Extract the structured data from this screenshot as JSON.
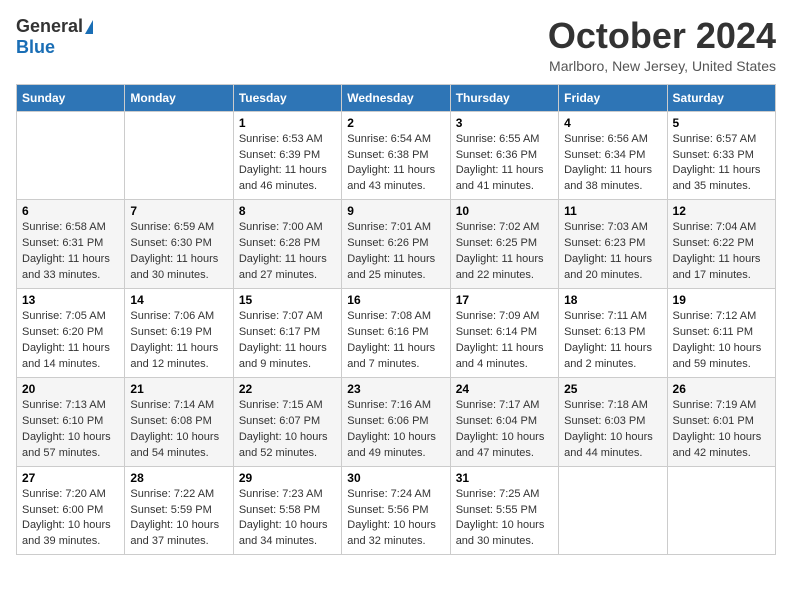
{
  "header": {
    "logo_general": "General",
    "logo_blue": "Blue",
    "title": "October 2024",
    "location": "Marlboro, New Jersey, United States"
  },
  "weekdays": [
    "Sunday",
    "Monday",
    "Tuesday",
    "Wednesday",
    "Thursday",
    "Friday",
    "Saturday"
  ],
  "weeks": [
    [
      {
        "day": "",
        "sunrise": "",
        "sunset": "",
        "daylight": ""
      },
      {
        "day": "",
        "sunrise": "",
        "sunset": "",
        "daylight": ""
      },
      {
        "day": "1",
        "sunrise": "Sunrise: 6:53 AM",
        "sunset": "Sunset: 6:39 PM",
        "daylight": "Daylight: 11 hours and 46 minutes."
      },
      {
        "day": "2",
        "sunrise": "Sunrise: 6:54 AM",
        "sunset": "Sunset: 6:38 PM",
        "daylight": "Daylight: 11 hours and 43 minutes."
      },
      {
        "day": "3",
        "sunrise": "Sunrise: 6:55 AM",
        "sunset": "Sunset: 6:36 PM",
        "daylight": "Daylight: 11 hours and 41 minutes."
      },
      {
        "day": "4",
        "sunrise": "Sunrise: 6:56 AM",
        "sunset": "Sunset: 6:34 PM",
        "daylight": "Daylight: 11 hours and 38 minutes."
      },
      {
        "day": "5",
        "sunrise": "Sunrise: 6:57 AM",
        "sunset": "Sunset: 6:33 PM",
        "daylight": "Daylight: 11 hours and 35 minutes."
      }
    ],
    [
      {
        "day": "6",
        "sunrise": "Sunrise: 6:58 AM",
        "sunset": "Sunset: 6:31 PM",
        "daylight": "Daylight: 11 hours and 33 minutes."
      },
      {
        "day": "7",
        "sunrise": "Sunrise: 6:59 AM",
        "sunset": "Sunset: 6:30 PM",
        "daylight": "Daylight: 11 hours and 30 minutes."
      },
      {
        "day": "8",
        "sunrise": "Sunrise: 7:00 AM",
        "sunset": "Sunset: 6:28 PM",
        "daylight": "Daylight: 11 hours and 27 minutes."
      },
      {
        "day": "9",
        "sunrise": "Sunrise: 7:01 AM",
        "sunset": "Sunset: 6:26 PM",
        "daylight": "Daylight: 11 hours and 25 minutes."
      },
      {
        "day": "10",
        "sunrise": "Sunrise: 7:02 AM",
        "sunset": "Sunset: 6:25 PM",
        "daylight": "Daylight: 11 hours and 22 minutes."
      },
      {
        "day": "11",
        "sunrise": "Sunrise: 7:03 AM",
        "sunset": "Sunset: 6:23 PM",
        "daylight": "Daylight: 11 hours and 20 minutes."
      },
      {
        "day": "12",
        "sunrise": "Sunrise: 7:04 AM",
        "sunset": "Sunset: 6:22 PM",
        "daylight": "Daylight: 11 hours and 17 minutes."
      }
    ],
    [
      {
        "day": "13",
        "sunrise": "Sunrise: 7:05 AM",
        "sunset": "Sunset: 6:20 PM",
        "daylight": "Daylight: 11 hours and 14 minutes."
      },
      {
        "day": "14",
        "sunrise": "Sunrise: 7:06 AM",
        "sunset": "Sunset: 6:19 PM",
        "daylight": "Daylight: 11 hours and 12 minutes."
      },
      {
        "day": "15",
        "sunrise": "Sunrise: 7:07 AM",
        "sunset": "Sunset: 6:17 PM",
        "daylight": "Daylight: 11 hours and 9 minutes."
      },
      {
        "day": "16",
        "sunrise": "Sunrise: 7:08 AM",
        "sunset": "Sunset: 6:16 PM",
        "daylight": "Daylight: 11 hours and 7 minutes."
      },
      {
        "day": "17",
        "sunrise": "Sunrise: 7:09 AM",
        "sunset": "Sunset: 6:14 PM",
        "daylight": "Daylight: 11 hours and 4 minutes."
      },
      {
        "day": "18",
        "sunrise": "Sunrise: 7:11 AM",
        "sunset": "Sunset: 6:13 PM",
        "daylight": "Daylight: 11 hours and 2 minutes."
      },
      {
        "day": "19",
        "sunrise": "Sunrise: 7:12 AM",
        "sunset": "Sunset: 6:11 PM",
        "daylight": "Daylight: 10 hours and 59 minutes."
      }
    ],
    [
      {
        "day": "20",
        "sunrise": "Sunrise: 7:13 AM",
        "sunset": "Sunset: 6:10 PM",
        "daylight": "Daylight: 10 hours and 57 minutes."
      },
      {
        "day": "21",
        "sunrise": "Sunrise: 7:14 AM",
        "sunset": "Sunset: 6:08 PM",
        "daylight": "Daylight: 10 hours and 54 minutes."
      },
      {
        "day": "22",
        "sunrise": "Sunrise: 7:15 AM",
        "sunset": "Sunset: 6:07 PM",
        "daylight": "Daylight: 10 hours and 52 minutes."
      },
      {
        "day": "23",
        "sunrise": "Sunrise: 7:16 AM",
        "sunset": "Sunset: 6:06 PM",
        "daylight": "Daylight: 10 hours and 49 minutes."
      },
      {
        "day": "24",
        "sunrise": "Sunrise: 7:17 AM",
        "sunset": "Sunset: 6:04 PM",
        "daylight": "Daylight: 10 hours and 47 minutes."
      },
      {
        "day": "25",
        "sunrise": "Sunrise: 7:18 AM",
        "sunset": "Sunset: 6:03 PM",
        "daylight": "Daylight: 10 hours and 44 minutes."
      },
      {
        "day": "26",
        "sunrise": "Sunrise: 7:19 AM",
        "sunset": "Sunset: 6:01 PM",
        "daylight": "Daylight: 10 hours and 42 minutes."
      }
    ],
    [
      {
        "day": "27",
        "sunrise": "Sunrise: 7:20 AM",
        "sunset": "Sunset: 6:00 PM",
        "daylight": "Daylight: 10 hours and 39 minutes."
      },
      {
        "day": "28",
        "sunrise": "Sunrise: 7:22 AM",
        "sunset": "Sunset: 5:59 PM",
        "daylight": "Daylight: 10 hours and 37 minutes."
      },
      {
        "day": "29",
        "sunrise": "Sunrise: 7:23 AM",
        "sunset": "Sunset: 5:58 PM",
        "daylight": "Daylight: 10 hours and 34 minutes."
      },
      {
        "day": "30",
        "sunrise": "Sunrise: 7:24 AM",
        "sunset": "Sunset: 5:56 PM",
        "daylight": "Daylight: 10 hours and 32 minutes."
      },
      {
        "day": "31",
        "sunrise": "Sunrise: 7:25 AM",
        "sunset": "Sunset: 5:55 PM",
        "daylight": "Daylight: 10 hours and 30 minutes."
      },
      {
        "day": "",
        "sunrise": "",
        "sunset": "",
        "daylight": ""
      },
      {
        "day": "",
        "sunrise": "",
        "sunset": "",
        "daylight": ""
      }
    ]
  ]
}
